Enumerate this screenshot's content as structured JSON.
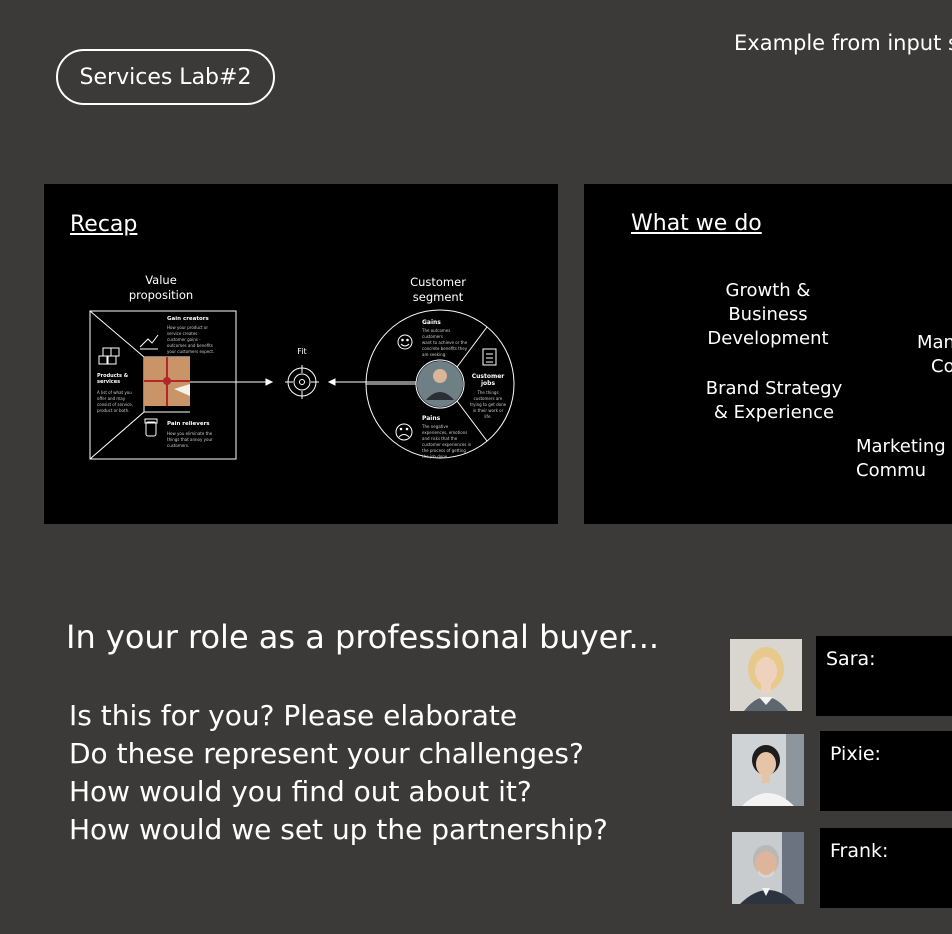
{
  "header": {
    "note": "Example from input ses",
    "session_pill": "Services Lab#2"
  },
  "recap_slide": {
    "title": "Recap",
    "value_prop_title": "Value proposition",
    "customer_segment_title": "Customer segment",
    "fit_label": "Fit",
    "gain_creators": {
      "title": "Gain creators",
      "desc": "How your product or service creates customer gains - outcomes and benefits your customers expect."
    },
    "products_services": {
      "title": "Products & services",
      "desc": "A list of what you offer and may consist of service, product or both."
    },
    "pain_relievers": {
      "title": "Pain relievers",
      "desc": "How you eliminate the things that annoy your customers."
    },
    "gains": {
      "title": "Gains",
      "desc": "The outcomes customers want to achieve or the concrete benefits they are seeking."
    },
    "customer_jobs": {
      "title": "Customer jobs",
      "desc": "The things customers are trying to get done in their work or life."
    },
    "pains": {
      "title": "Pains",
      "desc": "The negative experiences, emotions and risks that the customer experiences in the process of getting the job done."
    }
  },
  "what_we_do_slide": {
    "title": "What we do",
    "services": [
      "Growth & Business Development",
      "Mana Con",
      "Brand Strategy & Experience",
      "Marketing & Commu"
    ]
  },
  "prompt": {
    "heading": "In your role as a professional buyer...",
    "questions": [
      "Is this for you? Please elaborate",
      "Do these represent your challenges?",
      "How would you find out about it?",
      "How would we set up the partnership?"
    ]
  },
  "personas": [
    {
      "name": "Sara:",
      "photo": "woman-blonde-avatar"
    },
    {
      "name": "Pixie:",
      "photo": "woman-dark-hair-avatar"
    },
    {
      "name": "Frank:",
      "photo": "man-grey-hair-avatar"
    }
  ]
}
